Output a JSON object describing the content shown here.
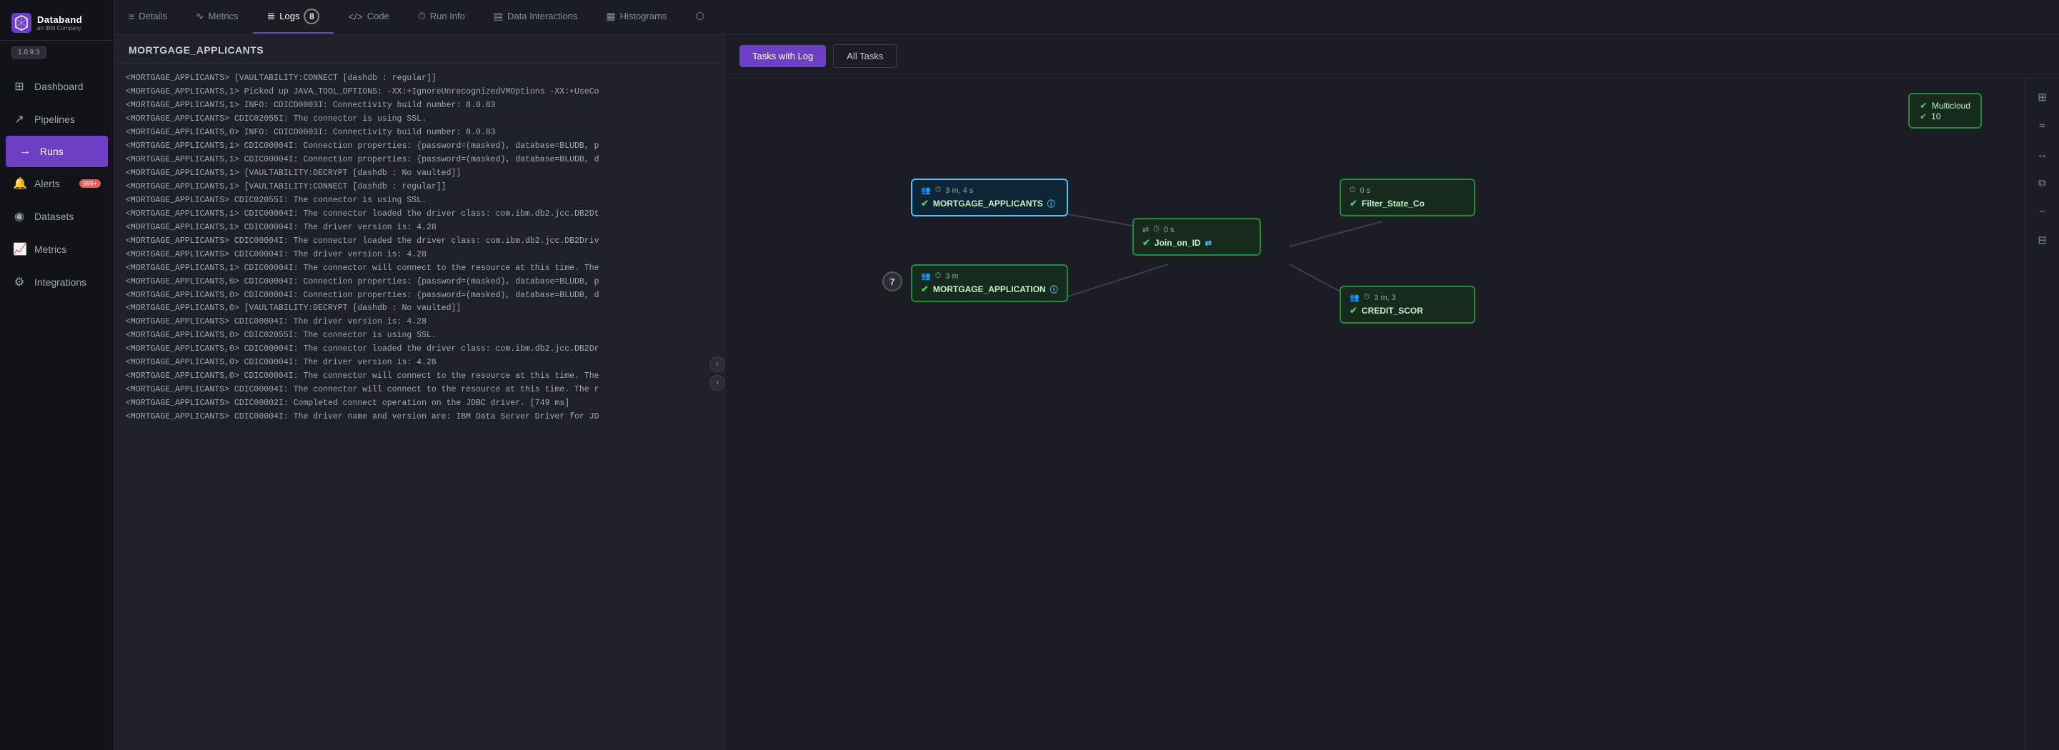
{
  "app": {
    "brand": "Databand",
    "sub": "an IBM Company",
    "version": "1.0.9.3"
  },
  "sidebar": {
    "items": [
      {
        "id": "dashboard",
        "label": "Dashboard",
        "icon": "⊞",
        "active": false
      },
      {
        "id": "pipelines",
        "label": "Pipelines",
        "icon": "↗",
        "active": false
      },
      {
        "id": "runs",
        "label": "Runs",
        "icon": "→",
        "active": true
      },
      {
        "id": "alerts",
        "label": "Alerts",
        "icon": "🔔",
        "active": false,
        "badge": "999+"
      },
      {
        "id": "datasets",
        "label": "Datasets",
        "icon": "⊚",
        "active": false
      },
      {
        "id": "metrics",
        "label": "Metrics",
        "icon": "📈",
        "active": false
      },
      {
        "id": "integrations",
        "label": "Integrations",
        "icon": "⚙",
        "active": false
      }
    ]
  },
  "tabs": [
    {
      "id": "details",
      "label": "Details",
      "icon": "≡",
      "active": false
    },
    {
      "id": "metrics",
      "label": "Metrics",
      "icon": "∿",
      "active": false
    },
    {
      "id": "logs",
      "label": "Logs",
      "icon": "≣",
      "active": true,
      "badge": "8"
    },
    {
      "id": "code",
      "label": "Code",
      "icon": "</>",
      "active": false
    },
    {
      "id": "run-info",
      "label": "Run Info",
      "icon": "⏱",
      "active": false
    },
    {
      "id": "data-interactions",
      "label": "Data Interactions",
      "icon": "⊟",
      "active": false
    },
    {
      "id": "histograms",
      "label": "Histograms",
      "icon": "▦",
      "active": false
    },
    {
      "id": "external",
      "label": "",
      "icon": "⬡",
      "active": false
    }
  ],
  "log_panel": {
    "title": "MORTGAGE_APPLICANTS",
    "lines": [
      "<MORTGAGE_APPLICANTS> [VAULTABILITY:CONNECT [dashdb : regular]]",
      "<MORTGAGE_APPLICANTS,1> Picked up JAVA_TOOL_OPTIONS: -XX:+IgnoreUnrecognizedVMOptions -XX:+UseCo",
      "<MORTGAGE_APPLICANTS,1> INFO: CDICO0003I: Connectivity build number: 8.0.83",
      "<MORTGAGE_APPLICANTS> CDIC02055I: The connector is using SSL.",
      "<MORTGAGE_APPLICANTS,0> INFO: CDICO0003I: Connectivity build number: 8.0.83",
      "<MORTGAGE_APPLICANTS,1> CDIC00004I: Connection properties: {password=(masked), database=BLUDB, p",
      "<MORTGAGE_APPLICANTS,1> CDIC00004I: Connection properties: {password=(masked), database=BLUDB, d",
      "<MORTGAGE_APPLICANTS,1> [VAULTABILITY:DECRYPT [dashdb : No vaulted]]",
      "<MORTGAGE_APPLICANTS,1> [VAULTABILITY:CONNECT [dashdb : regular]]",
      "<MORTGAGE_APPLICANTS> CDIC02055I: The connector is using SSL.",
      "<MORTGAGE_APPLICANTS,1> CDIC00004I: The connector loaded the driver class: com.ibm.db2.jcc.DB2Dt",
      "<MORTGAGE_APPLICANTS,1> CDIC00004I: The driver version is: 4.28",
      "<MORTGAGE_APPLICANTS> CDIC00004I: The connector loaded the driver class: com.ibm.db2.jcc.DB2Driv",
      "<MORTGAGE_APPLICANTS> CDIC00004I: The driver version is: 4.28",
      "<MORTGAGE_APPLICANTS,1> CDIC00004I: The connector will connect to the resource at this time. The",
      "<MORTGAGE_APPLICANTS,0> CDIC00004I: Connection properties: {password=(masked), database=BLUDB, p",
      "<MORTGAGE_APPLICANTS,0> CDIC00004I: Connection properties: {password=(masked), database=BLUDB, d",
      "<MORTGAGE_APPLICANTS,0> [VAULTABILITY:DECRYPT [dashdb : No vaulted]]",
      "<MORTGAGE_APPLICANTS> CDIC00004I: The driver version is: 4.28",
      "<MORTGAGE_APPLICANTS,0> CDIC02055I: The connector is using SSL.",
      "<MORTGAGE_APPLICANTS,0> CDIC00004I: The connector loaded the driver class: com.ibm.db2.jcc.DB2Dr",
      "<MORTGAGE_APPLICANTS,0> CDIC00004I: The driver version is: 4.28",
      "<MORTGAGE_APPLICANTS,0> CDIC00004I: The connector will connect to the resource at this time. The",
      "<MORTGAGE_APPLICANTS> CDIC00004I: The connector will connect to the resource at this time. The r",
      "<MORTGAGE_APPLICANTS> CDIC00002I: Completed connect operation on the JDBC driver. [749 ms]",
      "<MORTGAGE_APPLICANTS> CDIC00004I: The driver name and version are: IBM Data Server Driver for JD"
    ]
  },
  "graph": {
    "tasks_with_log_btn": "Tasks with Log",
    "all_tasks_btn": "All Tasks",
    "nodes": [
      {
        "id": "mortgage-applicants",
        "name": "MORTGAGE_APPLICANTS",
        "time": "3 m, 4 s",
        "persons": "1",
        "selected": true
      },
      {
        "id": "mortgage-application",
        "name": "MORTGAGE_APPLICATION",
        "time": "3 m",
        "persons": "1",
        "selected": false
      },
      {
        "id": "join-on-id",
        "name": "Join_on_ID",
        "time": "0 s",
        "persons": "2",
        "selected": false
      },
      {
        "id": "filter-state-co",
        "name": "Filter_State_Co",
        "time": "0 s",
        "persons": "1",
        "selected": false
      },
      {
        "id": "credit-score",
        "name": "CREDIT_SCOR",
        "time": "3 m, 3",
        "persons": "1",
        "selected": false
      },
      {
        "id": "multicloud",
        "name": "Multicloud",
        "count": "10",
        "selected": false
      }
    ],
    "circle_badge_7": "7",
    "right_icons": [
      "⊞",
      "≈",
      "↔",
      "⧉",
      "⊟",
      "−"
    ]
  }
}
